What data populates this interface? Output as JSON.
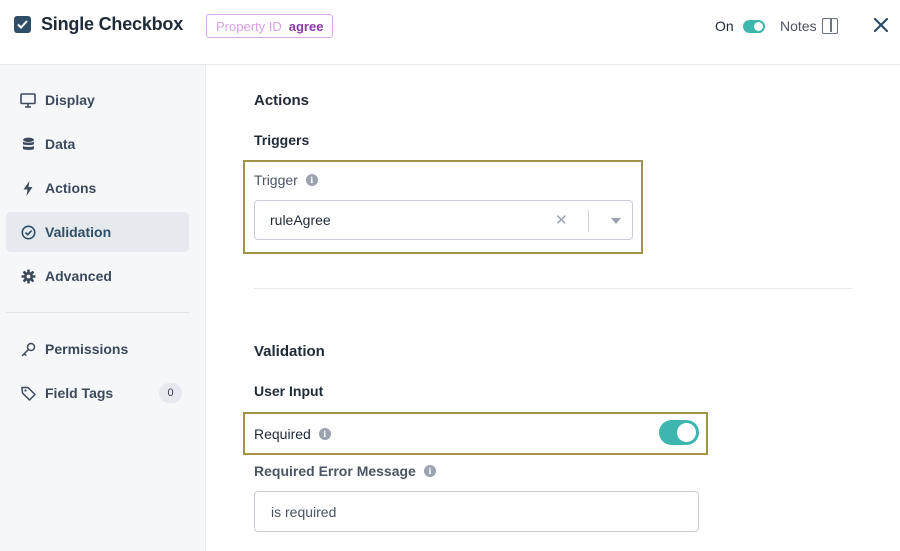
{
  "header": {
    "title": "Single Checkbox",
    "property_label": "Property ID",
    "property_value": "agree",
    "on_label": "On",
    "notes_label": "Notes"
  },
  "sidebar": {
    "items": [
      {
        "label": "Display",
        "icon": "monitor-icon"
      },
      {
        "label": "Data",
        "icon": "database-icon"
      },
      {
        "label": "Actions",
        "icon": "bolt-icon"
      },
      {
        "label": "Validation",
        "icon": "check-circle-icon",
        "active": true
      },
      {
        "label": "Advanced",
        "icon": "gear-icon"
      },
      {
        "label": "Permissions",
        "icon": "key-icon"
      },
      {
        "label": "Field Tags",
        "icon": "tag-icon",
        "count": "0"
      }
    ]
  },
  "main": {
    "actions_title": "Actions",
    "triggers_title": "Triggers",
    "trigger_label": "Trigger",
    "trigger_value": "ruleAgree",
    "validation_title": "Validation",
    "user_input_title": "User Input",
    "required_label": "Required",
    "required_on": true,
    "error_message_label": "Required Error Message",
    "error_message_value": "is required"
  },
  "colors": {
    "accent": "#3fb5b0",
    "highlight_border": "#a3924a",
    "badge_border": "#d9a6e6",
    "badge_value": "#8a3aa6"
  }
}
